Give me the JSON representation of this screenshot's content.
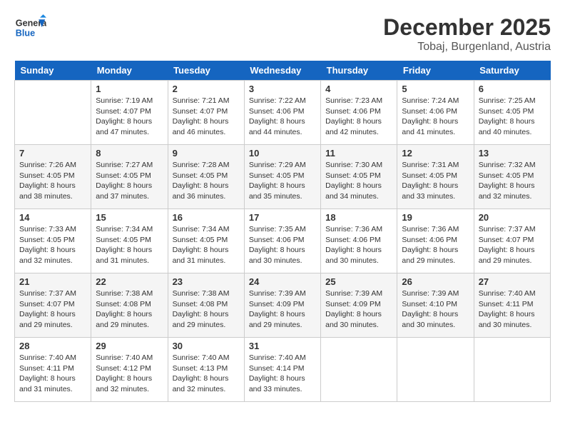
{
  "header": {
    "logo": {
      "general": "General",
      "blue": "Blue"
    },
    "month_year": "December 2025",
    "location": "Tobaj, Burgenland, Austria"
  },
  "weekdays": [
    "Sunday",
    "Monday",
    "Tuesday",
    "Wednesday",
    "Thursday",
    "Friday",
    "Saturday"
  ],
  "weeks": [
    [
      {
        "day": "",
        "sunrise": "",
        "sunset": "",
        "daylight": ""
      },
      {
        "day": "1",
        "sunrise": "Sunrise: 7:19 AM",
        "sunset": "Sunset: 4:07 PM",
        "daylight": "Daylight: 8 hours and 47 minutes."
      },
      {
        "day": "2",
        "sunrise": "Sunrise: 7:21 AM",
        "sunset": "Sunset: 4:07 PM",
        "daylight": "Daylight: 8 hours and 46 minutes."
      },
      {
        "day": "3",
        "sunrise": "Sunrise: 7:22 AM",
        "sunset": "Sunset: 4:06 PM",
        "daylight": "Daylight: 8 hours and 44 minutes."
      },
      {
        "day": "4",
        "sunrise": "Sunrise: 7:23 AM",
        "sunset": "Sunset: 4:06 PM",
        "daylight": "Daylight: 8 hours and 42 minutes."
      },
      {
        "day": "5",
        "sunrise": "Sunrise: 7:24 AM",
        "sunset": "Sunset: 4:06 PM",
        "daylight": "Daylight: 8 hours and 41 minutes."
      },
      {
        "day": "6",
        "sunrise": "Sunrise: 7:25 AM",
        "sunset": "Sunset: 4:05 PM",
        "daylight": "Daylight: 8 hours and 40 minutes."
      }
    ],
    [
      {
        "day": "7",
        "sunrise": "Sunrise: 7:26 AM",
        "sunset": "Sunset: 4:05 PM",
        "daylight": "Daylight: 8 hours and 38 minutes."
      },
      {
        "day": "8",
        "sunrise": "Sunrise: 7:27 AM",
        "sunset": "Sunset: 4:05 PM",
        "daylight": "Daylight: 8 hours and 37 minutes."
      },
      {
        "day": "9",
        "sunrise": "Sunrise: 7:28 AM",
        "sunset": "Sunset: 4:05 PM",
        "daylight": "Daylight: 8 hours and 36 minutes."
      },
      {
        "day": "10",
        "sunrise": "Sunrise: 7:29 AM",
        "sunset": "Sunset: 4:05 PM",
        "daylight": "Daylight: 8 hours and 35 minutes."
      },
      {
        "day": "11",
        "sunrise": "Sunrise: 7:30 AM",
        "sunset": "Sunset: 4:05 PM",
        "daylight": "Daylight: 8 hours and 34 minutes."
      },
      {
        "day": "12",
        "sunrise": "Sunrise: 7:31 AM",
        "sunset": "Sunset: 4:05 PM",
        "daylight": "Daylight: 8 hours and 33 minutes."
      },
      {
        "day": "13",
        "sunrise": "Sunrise: 7:32 AM",
        "sunset": "Sunset: 4:05 PM",
        "daylight": "Daylight: 8 hours and 32 minutes."
      }
    ],
    [
      {
        "day": "14",
        "sunrise": "Sunrise: 7:33 AM",
        "sunset": "Sunset: 4:05 PM",
        "daylight": "Daylight: 8 hours and 32 minutes."
      },
      {
        "day": "15",
        "sunrise": "Sunrise: 7:34 AM",
        "sunset": "Sunset: 4:05 PM",
        "daylight": "Daylight: 8 hours and 31 minutes."
      },
      {
        "day": "16",
        "sunrise": "Sunrise: 7:34 AM",
        "sunset": "Sunset: 4:05 PM",
        "daylight": "Daylight: 8 hours and 31 minutes."
      },
      {
        "day": "17",
        "sunrise": "Sunrise: 7:35 AM",
        "sunset": "Sunset: 4:06 PM",
        "daylight": "Daylight: 8 hours and 30 minutes."
      },
      {
        "day": "18",
        "sunrise": "Sunrise: 7:36 AM",
        "sunset": "Sunset: 4:06 PM",
        "daylight": "Daylight: 8 hours and 30 minutes."
      },
      {
        "day": "19",
        "sunrise": "Sunrise: 7:36 AM",
        "sunset": "Sunset: 4:06 PM",
        "daylight": "Daylight: 8 hours and 29 minutes."
      },
      {
        "day": "20",
        "sunrise": "Sunrise: 7:37 AM",
        "sunset": "Sunset: 4:07 PM",
        "daylight": "Daylight: 8 hours and 29 minutes."
      }
    ],
    [
      {
        "day": "21",
        "sunrise": "Sunrise: 7:37 AM",
        "sunset": "Sunset: 4:07 PM",
        "daylight": "Daylight: 8 hours and 29 minutes."
      },
      {
        "day": "22",
        "sunrise": "Sunrise: 7:38 AM",
        "sunset": "Sunset: 4:08 PM",
        "daylight": "Daylight: 8 hours and 29 minutes."
      },
      {
        "day": "23",
        "sunrise": "Sunrise: 7:38 AM",
        "sunset": "Sunset: 4:08 PM",
        "daylight": "Daylight: 8 hours and 29 minutes."
      },
      {
        "day": "24",
        "sunrise": "Sunrise: 7:39 AM",
        "sunset": "Sunset: 4:09 PM",
        "daylight": "Daylight: 8 hours and 29 minutes."
      },
      {
        "day": "25",
        "sunrise": "Sunrise: 7:39 AM",
        "sunset": "Sunset: 4:09 PM",
        "daylight": "Daylight: 8 hours and 30 minutes."
      },
      {
        "day": "26",
        "sunrise": "Sunrise: 7:39 AM",
        "sunset": "Sunset: 4:10 PM",
        "daylight": "Daylight: 8 hours and 30 minutes."
      },
      {
        "day": "27",
        "sunrise": "Sunrise: 7:40 AM",
        "sunset": "Sunset: 4:11 PM",
        "daylight": "Daylight: 8 hours and 30 minutes."
      }
    ],
    [
      {
        "day": "28",
        "sunrise": "Sunrise: 7:40 AM",
        "sunset": "Sunset: 4:11 PM",
        "daylight": "Daylight: 8 hours and 31 minutes."
      },
      {
        "day": "29",
        "sunrise": "Sunrise: 7:40 AM",
        "sunset": "Sunset: 4:12 PM",
        "daylight": "Daylight: 8 hours and 32 minutes."
      },
      {
        "day": "30",
        "sunrise": "Sunrise: 7:40 AM",
        "sunset": "Sunset: 4:13 PM",
        "daylight": "Daylight: 8 hours and 32 minutes."
      },
      {
        "day": "31",
        "sunrise": "Sunrise: 7:40 AM",
        "sunset": "Sunset: 4:14 PM",
        "daylight": "Daylight: 8 hours and 33 minutes."
      },
      {
        "day": "",
        "sunrise": "",
        "sunset": "",
        "daylight": ""
      },
      {
        "day": "",
        "sunrise": "",
        "sunset": "",
        "daylight": ""
      },
      {
        "day": "",
        "sunrise": "",
        "sunset": "",
        "daylight": ""
      }
    ]
  ]
}
